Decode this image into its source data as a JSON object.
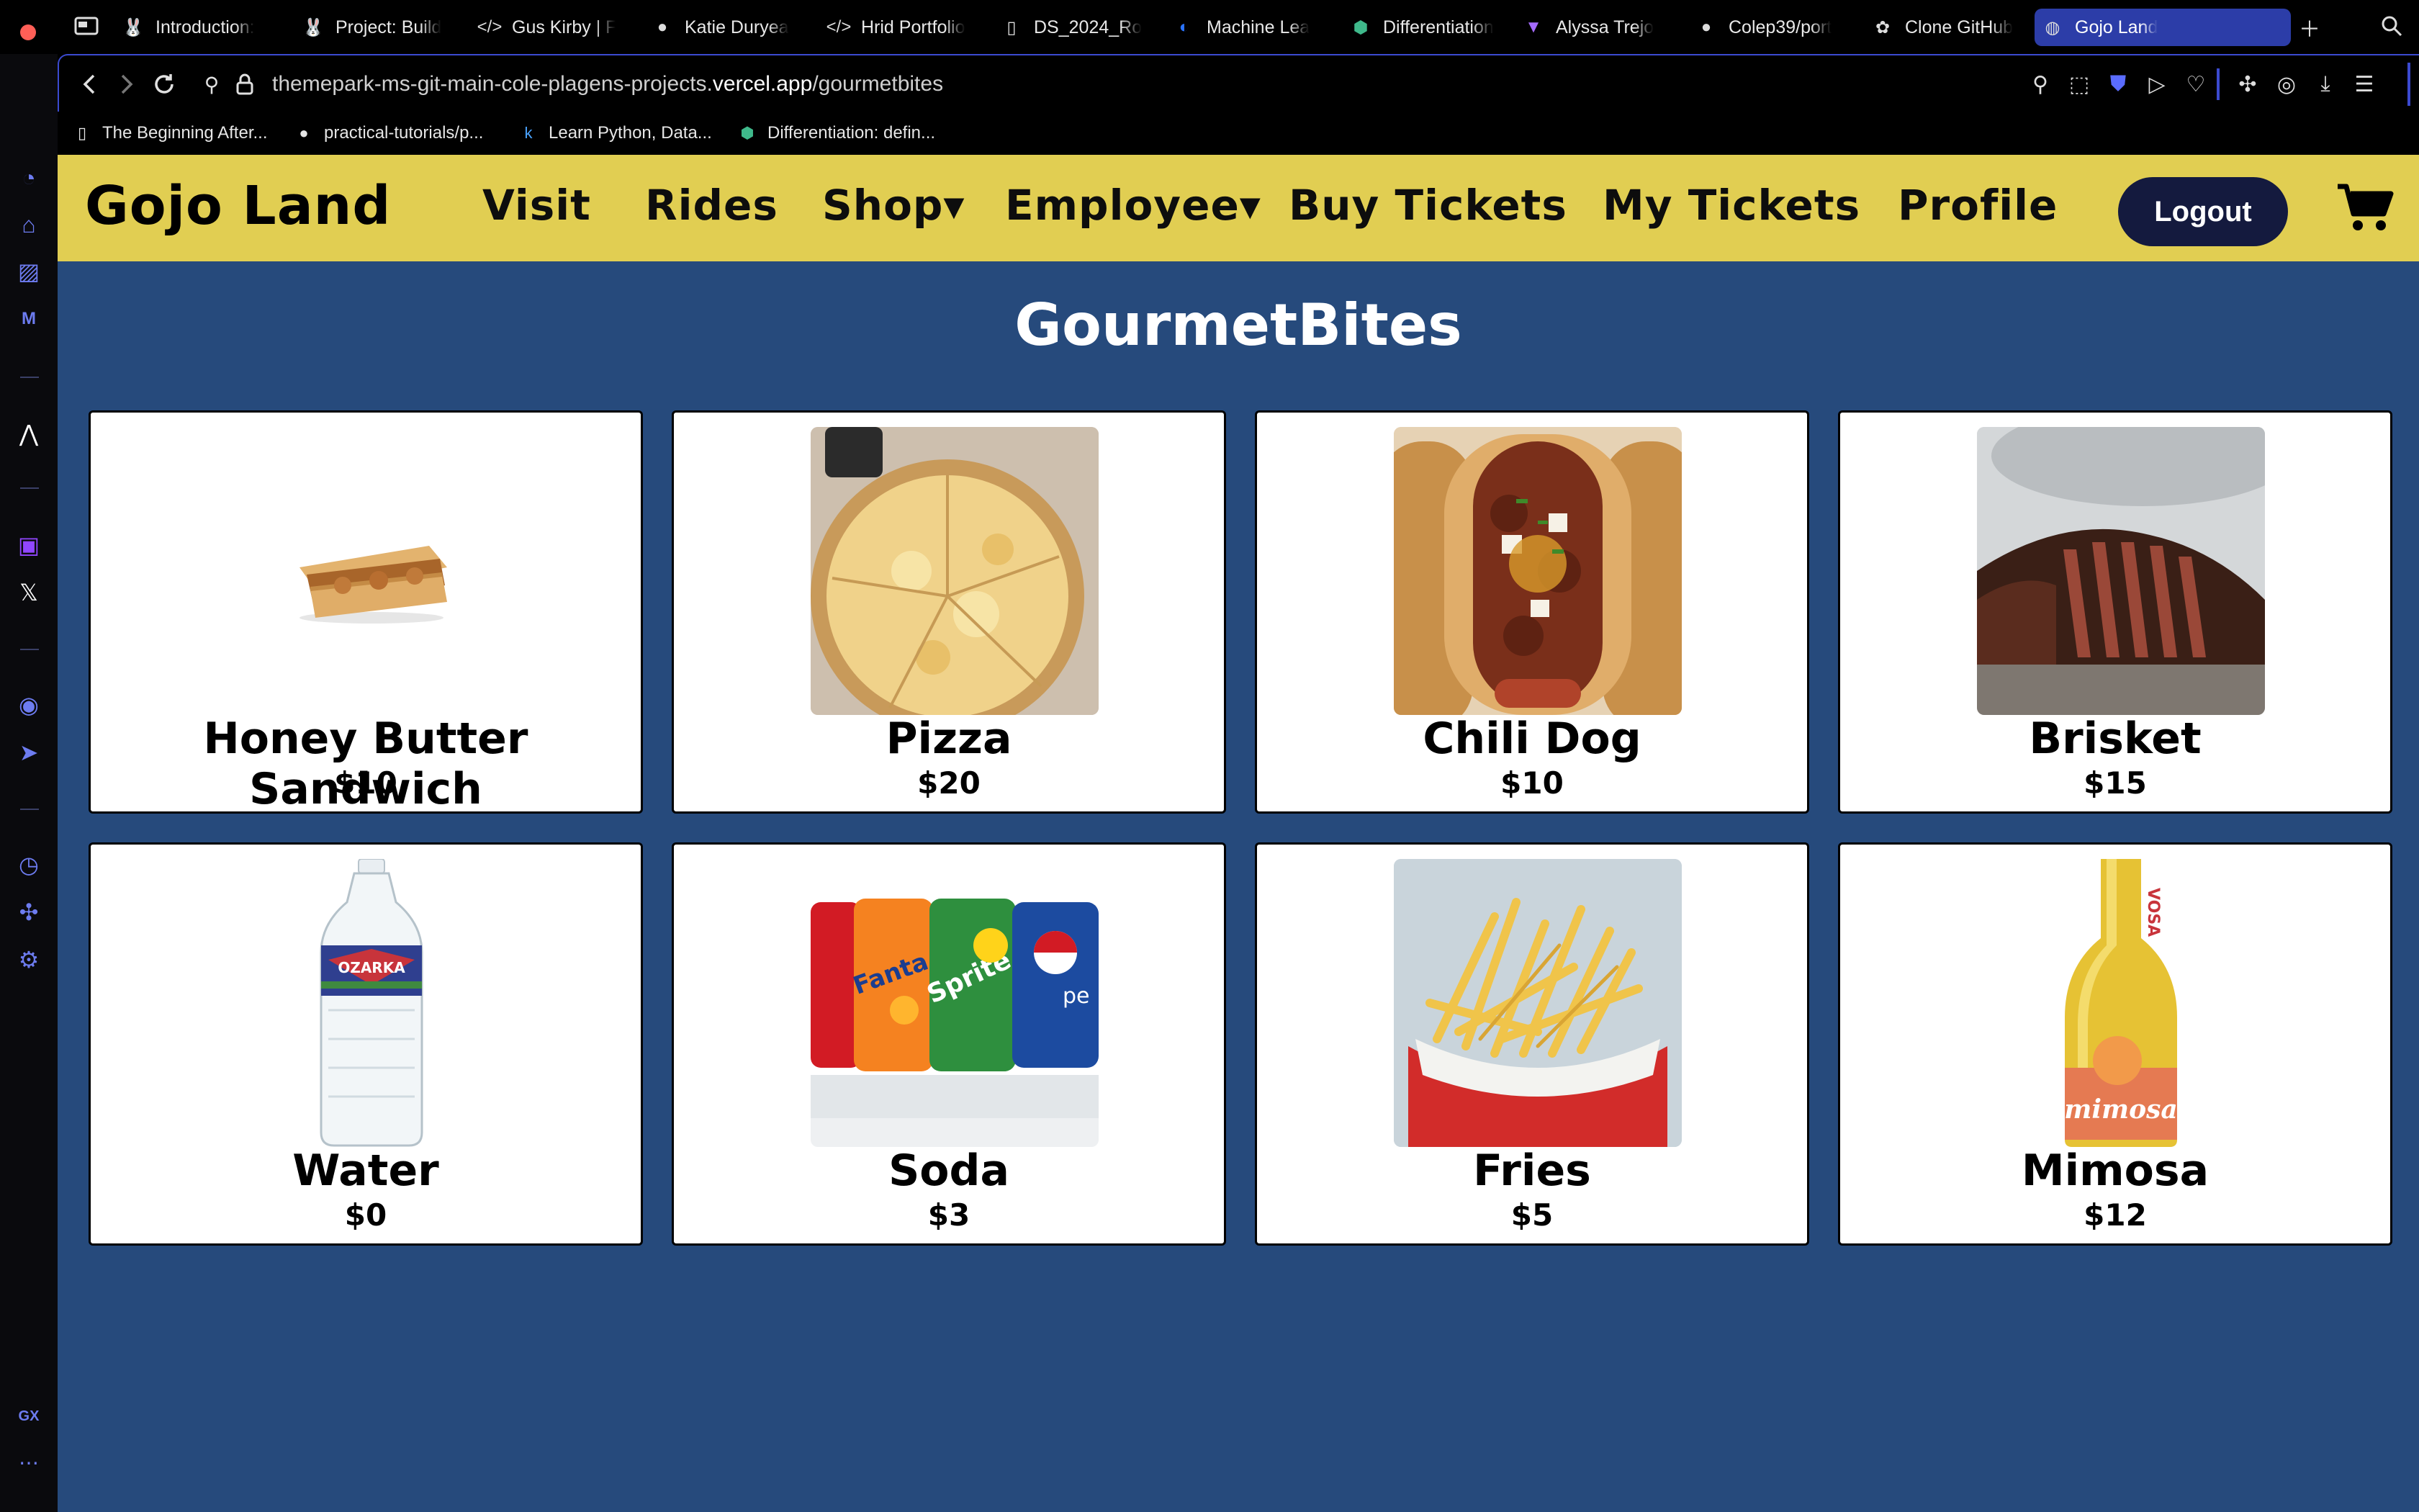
{
  "browser": {
    "tabs": [
      {
        "label": "Introduction: ",
        "icon": "bunny-icon"
      },
      {
        "label": "Project: Build",
        "icon": "bunny-icon"
      },
      {
        "label": "Gus Kirby | Fr",
        "icon": "code-icon"
      },
      {
        "label": "Katie Duryea",
        "icon": "planet-icon"
      },
      {
        "label": "Hrid Portfolio",
        "icon": "code-icon"
      },
      {
        "label": "DS_2024_Ro",
        "icon": "document-icon"
      },
      {
        "label": "Machine Lea",
        "icon": "coursera-icon"
      },
      {
        "label": "Differentiation",
        "icon": "hexagon-icon"
      },
      {
        "label": "Alyssa Trejo",
        "icon": "vite-icon"
      },
      {
        "label": "Colep39/port",
        "icon": "github-icon"
      },
      {
        "label": "Clone GitHub",
        "icon": "openai-icon"
      },
      {
        "label": "Gojo Land",
        "icon": "globe-icon",
        "active": true
      }
    ],
    "url_prefix": "themepark-ms-git-main-cole-plagens-projects.",
    "url_domain": "vercel.app",
    "url_path": "/gourmetbites",
    "bookmarks": [
      {
        "label": "The Beginning After...",
        "icon": "document-icon"
      },
      {
        "label": "practical-tutorials/p...",
        "icon": "github-icon"
      },
      {
        "label": "Learn Python, Data...",
        "icon": "k-icon"
      },
      {
        "label": "Differentiation: defin...",
        "icon": "hexagon-icon"
      }
    ],
    "sidebar_gx": "GX",
    "accent": "#3b4ad0"
  },
  "site": {
    "brand": "Gojo Land",
    "nav": [
      "Visit",
      "Rides",
      "Shop▾",
      "Employee▾",
      "Buy Tickets",
      "My Tickets",
      "Profile"
    ],
    "logout_label": "Logout",
    "navbar_color": "#e1ce52",
    "background_color": "#264a7c"
  },
  "main": {
    "title": "GourmetBites",
    "items": [
      {
        "name": "Honey Butter Sandwich",
        "price": "$10",
        "icon": "sandwich-image"
      },
      {
        "name": "Pizza",
        "price": "$20",
        "icon": "pizza-image"
      },
      {
        "name": "Chili Dog",
        "price": "$10",
        "icon": "chili-dog-image"
      },
      {
        "name": "Brisket",
        "price": "$15",
        "icon": "brisket-image"
      },
      {
        "name": "Water",
        "price": "$0",
        "icon": "water-bottle-image"
      },
      {
        "name": "Soda",
        "price": "$3",
        "icon": "soda-cans-image"
      },
      {
        "name": "Fries",
        "price": "$5",
        "icon": "fries-image"
      },
      {
        "name": "Mimosa",
        "price": "$12",
        "icon": "mimosa-bottle-image"
      }
    ]
  }
}
